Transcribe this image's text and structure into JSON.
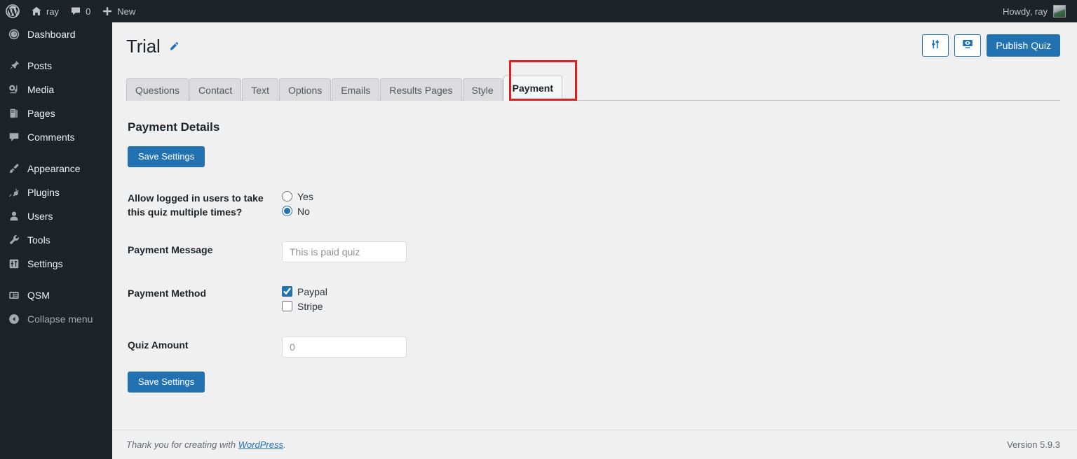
{
  "adminbar": {
    "logo_icon": "wordpress-logo-icon",
    "site_name": "ray",
    "site_icon": "home-icon",
    "comments_icon": "comment-bubble-icon",
    "comments_count": "0",
    "new_icon": "plus-icon",
    "new_label": "New",
    "howdy": "Howdy, ray",
    "avatar_icon": "user-avatar"
  },
  "sidebar": {
    "items": [
      {
        "label": "Dashboard",
        "icon": "dashboard-gauge-icon",
        "gap_after": true
      },
      {
        "label": "Posts",
        "icon": "pin-icon",
        "gap_after": false
      },
      {
        "label": "Media",
        "icon": "media-camera-icon",
        "gap_after": false
      },
      {
        "label": "Pages",
        "icon": "pages-icon",
        "gap_after": false
      },
      {
        "label": "Comments",
        "icon": "comment-bubble-icon",
        "gap_after": true
      },
      {
        "label": "Appearance",
        "icon": "paintbrush-icon",
        "gap_after": false
      },
      {
        "label": "Plugins",
        "icon": "plugin-plug-icon",
        "gap_after": false
      },
      {
        "label": "Users",
        "icon": "user-icon",
        "gap_after": false
      },
      {
        "label": "Tools",
        "icon": "wrench-icon",
        "gap_after": false
      },
      {
        "label": "Settings",
        "icon": "sliders-icon",
        "gap_after": true
      },
      {
        "label": "QSM",
        "icon": "form-list-icon",
        "gap_after": false
      }
    ],
    "collapse_label": "Collapse menu",
    "collapse_icon": "chevron-left-circle-icon"
  },
  "header": {
    "title": "Trial",
    "edit_icon": "pencil-icon",
    "settings_button_icon": "sliders-icon",
    "preview_button_icon": "preview-monitor-eye-icon",
    "publish_label": "Publish Quiz"
  },
  "tabs": {
    "items": [
      {
        "label": "Questions",
        "active": false
      },
      {
        "label": "Contact",
        "active": false
      },
      {
        "label": "Text",
        "active": false
      },
      {
        "label": "Options",
        "active": false
      },
      {
        "label": "Emails",
        "active": false
      },
      {
        "label": "Results Pages",
        "active": false
      },
      {
        "label": "Style",
        "active": false
      },
      {
        "label": "Payment",
        "active": true
      }
    ],
    "highlight_color": "#e02020",
    "highlighted_tab": "Payment"
  },
  "panel": {
    "section_title": "Payment Details",
    "save_top_label": "Save Settings",
    "save_bottom_label": "Save Settings",
    "fields": {
      "multiple_times": {
        "label": "Allow logged in users to take this quiz multiple times?",
        "options": [
          {
            "label": "Yes",
            "checked": false
          },
          {
            "label": "No",
            "checked": true
          }
        ]
      },
      "payment_message": {
        "label": "Payment Message",
        "value": "",
        "placeholder": "This is paid quiz"
      },
      "payment_method": {
        "label": "Payment Method",
        "options": [
          {
            "label": "Paypal",
            "checked": true
          },
          {
            "label": "Stripe",
            "checked": false
          }
        ]
      },
      "quiz_amount": {
        "label": "Quiz Amount",
        "value": "",
        "placeholder": "0"
      }
    }
  },
  "footer": {
    "thanks_prefix": "Thank you for creating with ",
    "wordpress_link": "WordPress",
    "thanks_suffix": ".",
    "version": "Version 5.9.3"
  },
  "colors": {
    "accent": "#2271b1",
    "sidebar_bg": "#1d2327",
    "page_bg": "#f0f0f1",
    "highlight": "#e02020"
  }
}
